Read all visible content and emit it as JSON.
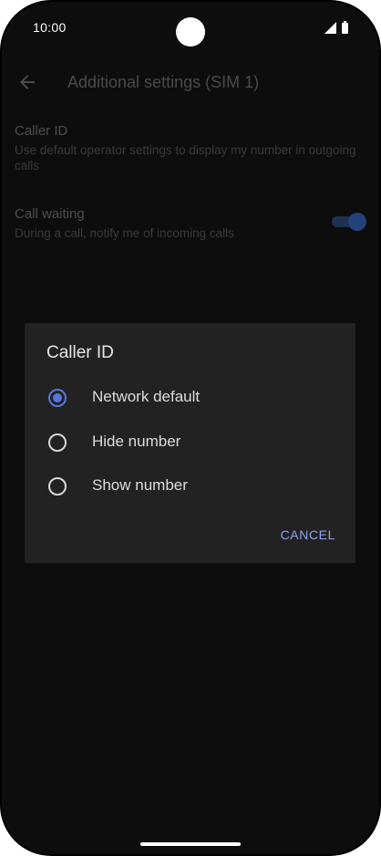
{
  "status_bar": {
    "time": "10:00",
    "icons": [
      "signal-icon",
      "battery-icon"
    ]
  },
  "app_bar": {
    "back_icon": "back-arrow-icon",
    "title": "Additional settings (SIM 1)"
  },
  "settings": [
    {
      "title": "Caller ID",
      "summary": "Use default operator settings to display my number in outgoing calls"
    },
    {
      "title": "Call waiting",
      "summary": "During a call, notify me of incoming calls",
      "toggle_on": true
    }
  ],
  "dialog": {
    "title": "Caller ID",
    "options": [
      {
        "label": "Network default",
        "selected": true
      },
      {
        "label": "Hide number",
        "selected": false
      },
      {
        "label": "Show number",
        "selected": false
      }
    ],
    "cancel_label": "CANCEL"
  },
  "colors": {
    "accent": "#5577dd",
    "dialog_background": "#222222",
    "screen_background": "#0d0d0d"
  }
}
